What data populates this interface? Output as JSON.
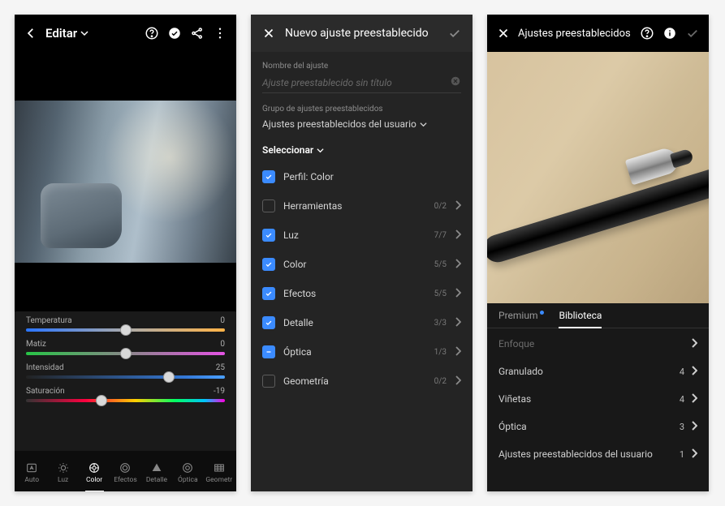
{
  "panel1": {
    "header": {
      "title": "Editar"
    },
    "sliders": [
      {
        "label": "Temperatura",
        "value": "0",
        "pos": 50,
        "track": "temp"
      },
      {
        "label": "Matiz",
        "value": "0",
        "pos": 50,
        "track": "matiz"
      },
      {
        "label": "Intensidad",
        "value": "25",
        "pos": 72,
        "track": "int"
      },
      {
        "label": "Saturación",
        "value": "-19",
        "pos": 38,
        "track": "sat"
      }
    ],
    "nav": [
      {
        "id": "auto",
        "label": "Auto"
      },
      {
        "id": "luz",
        "label": "Luz"
      },
      {
        "id": "color",
        "label": "Color",
        "active": true
      },
      {
        "id": "efectos",
        "label": "Efectos"
      },
      {
        "id": "detalle",
        "label": "Detalle"
      },
      {
        "id": "optica",
        "label": "Óptica"
      },
      {
        "id": "geom",
        "label": "Geometr"
      }
    ]
  },
  "panel2": {
    "title": "Nuevo ajuste preestablecido",
    "name_label": "Nombre del ajuste",
    "name_placeholder": "Ajuste preestablecido sin título",
    "group_label": "Grupo de ajustes preestablecidos",
    "group_value": "Ajustes preestablecidos del usuario",
    "select_label": "Seleccionar",
    "options": [
      {
        "label": "Perfil: Color",
        "state": "on",
        "count": "",
        "expandable": false
      },
      {
        "label": "Herramientas",
        "state": "off",
        "count": "0/2",
        "expandable": true
      },
      {
        "label": "Luz",
        "state": "on",
        "count": "7/7",
        "expandable": true
      },
      {
        "label": "Color",
        "state": "on",
        "count": "5/5",
        "expandable": true
      },
      {
        "label": "Efectos",
        "state": "on",
        "count": "5/5",
        "expandable": true
      },
      {
        "label": "Detalle",
        "state": "on",
        "count": "3/3",
        "expandable": true
      },
      {
        "label": "Óptica",
        "state": "mixed",
        "count": "1/3",
        "expandable": true
      },
      {
        "label": "Geometría",
        "state": "off",
        "count": "0/2",
        "expandable": true
      }
    ]
  },
  "panel3": {
    "title": "Ajustes preestablecidos",
    "tabs": [
      {
        "label": "Premium",
        "badge": true,
        "active": false
      },
      {
        "label": "Biblioteca",
        "badge": false,
        "active": true
      }
    ],
    "rows": [
      {
        "label": "Enfoque",
        "count": "",
        "dim": true
      },
      {
        "label": "Granulado",
        "count": "4"
      },
      {
        "label": "Viñetas",
        "count": "4"
      },
      {
        "label": "Óptica",
        "count": "3"
      },
      {
        "label": "Ajustes preestablecidos del usuario",
        "count": "1"
      }
    ]
  }
}
